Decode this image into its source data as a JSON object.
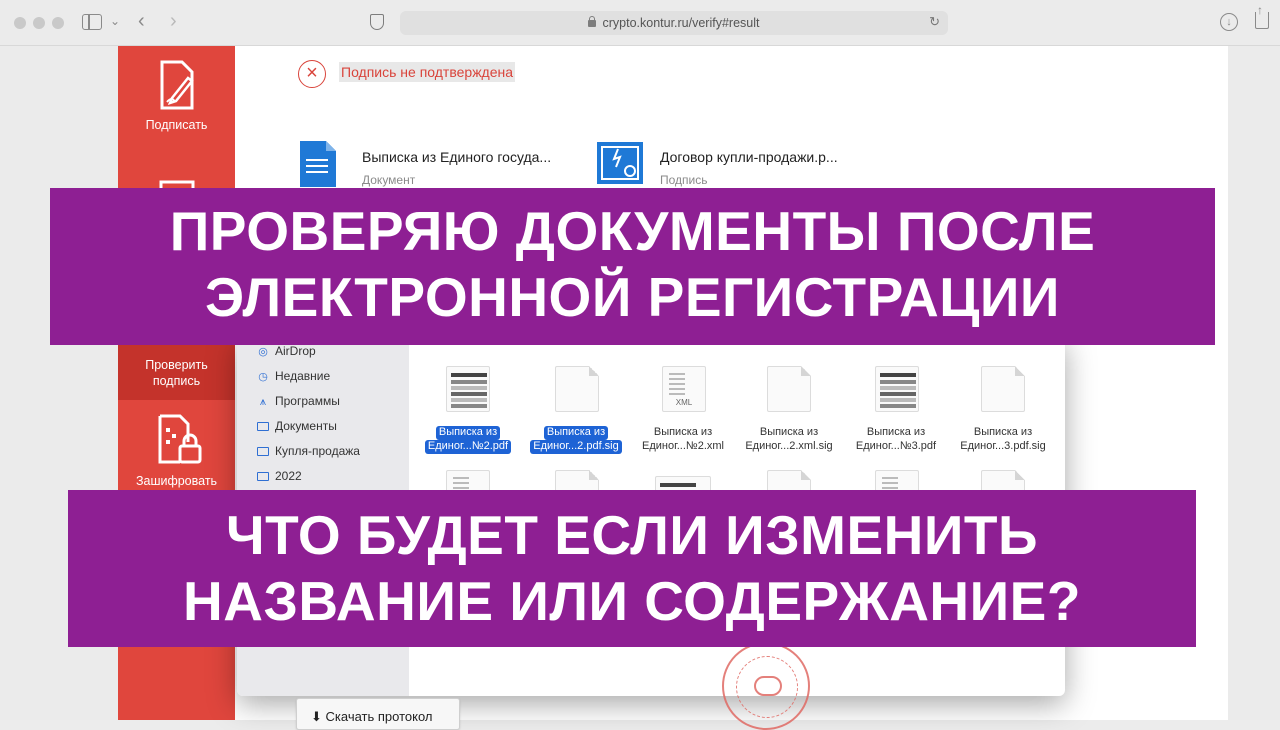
{
  "browser": {
    "url": "crypto.kontur.ru/verify#result"
  },
  "sidebar": {
    "items": [
      {
        "label": "Подписать",
        "icon": "sign-document-icon"
      },
      {
        "label": "Проверить подпись",
        "icon": "verify-signature-icon"
      },
      {
        "label": "Зашифровать",
        "icon": "encrypt-lock-icon"
      }
    ]
  },
  "result": {
    "status": "Подпись не подтверждена",
    "status_color": "#d9443b",
    "files": [
      {
        "name": "Выписка из Единого госуда...",
        "type": "Документ",
        "icon": "document-icon"
      },
      {
        "name": "Договор купли-продажи.p...",
        "type": "Подпись",
        "icon": "signature-certificate-icon"
      }
    ]
  },
  "file_dialog": {
    "sidebar": [
      {
        "label": "AirDrop",
        "icon": "airdrop-icon"
      },
      {
        "label": "Недавние",
        "icon": "clock-icon"
      },
      {
        "label": "Программы",
        "icon": "apps-icon"
      },
      {
        "label": "Документы",
        "icon": "folder-icon"
      },
      {
        "label": "Купля-продажа",
        "icon": "folder-icon"
      },
      {
        "label": "2022",
        "icon": "folder-icon"
      }
    ],
    "files": [
      {
        "line1": "Выписка из",
        "line2": "Единог...№2.pdf",
        "selected": true,
        "kind": "pdf"
      },
      {
        "line1": "Выписка из",
        "line2": "Единог...2.pdf.sig",
        "selected": true,
        "kind": "blank"
      },
      {
        "line1": "Выписка из",
        "line2": "Единог...№2.xml",
        "selected": false,
        "kind": "xml"
      },
      {
        "line1": "Выписка из",
        "line2": "Единог...2.xml.sig",
        "selected": false,
        "kind": "blank"
      },
      {
        "line1": "Выписка из",
        "line2": "Единог...№3.pdf",
        "selected": false,
        "kind": "pdf"
      },
      {
        "line1": "Выписка из",
        "line2": "Единог...3.pdf.sig",
        "selected": false,
        "kind": "blank"
      }
    ]
  },
  "banners": {
    "top_line1": "ПРОВЕРЯЮ ДОКУМЕНТЫ ПОСЛЕ",
    "top_line2": "ЭЛЕКТРОННОЙ РЕГИСТРАЦИИ",
    "bottom_line1": "ЧТО БУДЕТ ЕСЛИ ИЗМЕНИТЬ",
    "bottom_line2": "НАЗВАНИЕ ИЛИ СОДЕРЖАНИЕ?",
    "color": "#8e1f93"
  },
  "footer": {
    "download_button": "Скачать протокол"
  }
}
